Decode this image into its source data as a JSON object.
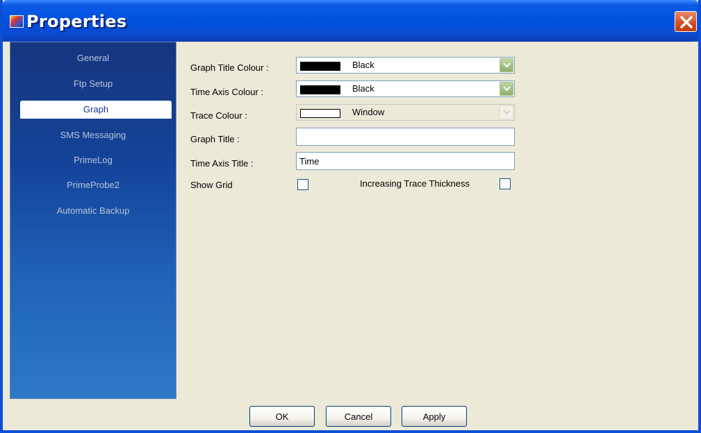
{
  "window": {
    "title": "Properties"
  },
  "sidebar": {
    "items": [
      {
        "label": "General"
      },
      {
        "label": "Ftp Setup"
      },
      {
        "label": "Graph",
        "active": true
      },
      {
        "label": "SMS Messaging"
      },
      {
        "label": "PrimeLog"
      },
      {
        "label": "PrimeProbe2"
      },
      {
        "label": "Automatic Backup"
      }
    ]
  },
  "graph": {
    "graph_title_colour": {
      "label": "Graph Title Colour :",
      "value": "Black",
      "swatch": "#000000"
    },
    "time_axis_colour": {
      "label": "Time Axis Colour :",
      "value": "Black",
      "swatch": "#000000"
    },
    "trace_colour": {
      "label": "Trace Colour :",
      "value": "Window",
      "swatch": "#ffffff"
    },
    "graph_title": {
      "label": "Graph Title :",
      "value": ""
    },
    "time_axis_title": {
      "label": "Time Axis Title :",
      "value": "Time"
    },
    "show_grid": {
      "label": "Show Grid",
      "checked": false
    },
    "increasing_trace_thickness": {
      "label": "Increasing Trace Thickness",
      "checked": false
    }
  },
  "buttons": {
    "ok": "OK",
    "cancel": "Cancel",
    "apply": "Apply"
  },
  "colors": {
    "titlebar": "#0052e0",
    "sidebar_top": "#16357e",
    "sidebar_bottom": "#2e78c6",
    "close": "#d54a20",
    "window_bg": "#ece9d8"
  }
}
